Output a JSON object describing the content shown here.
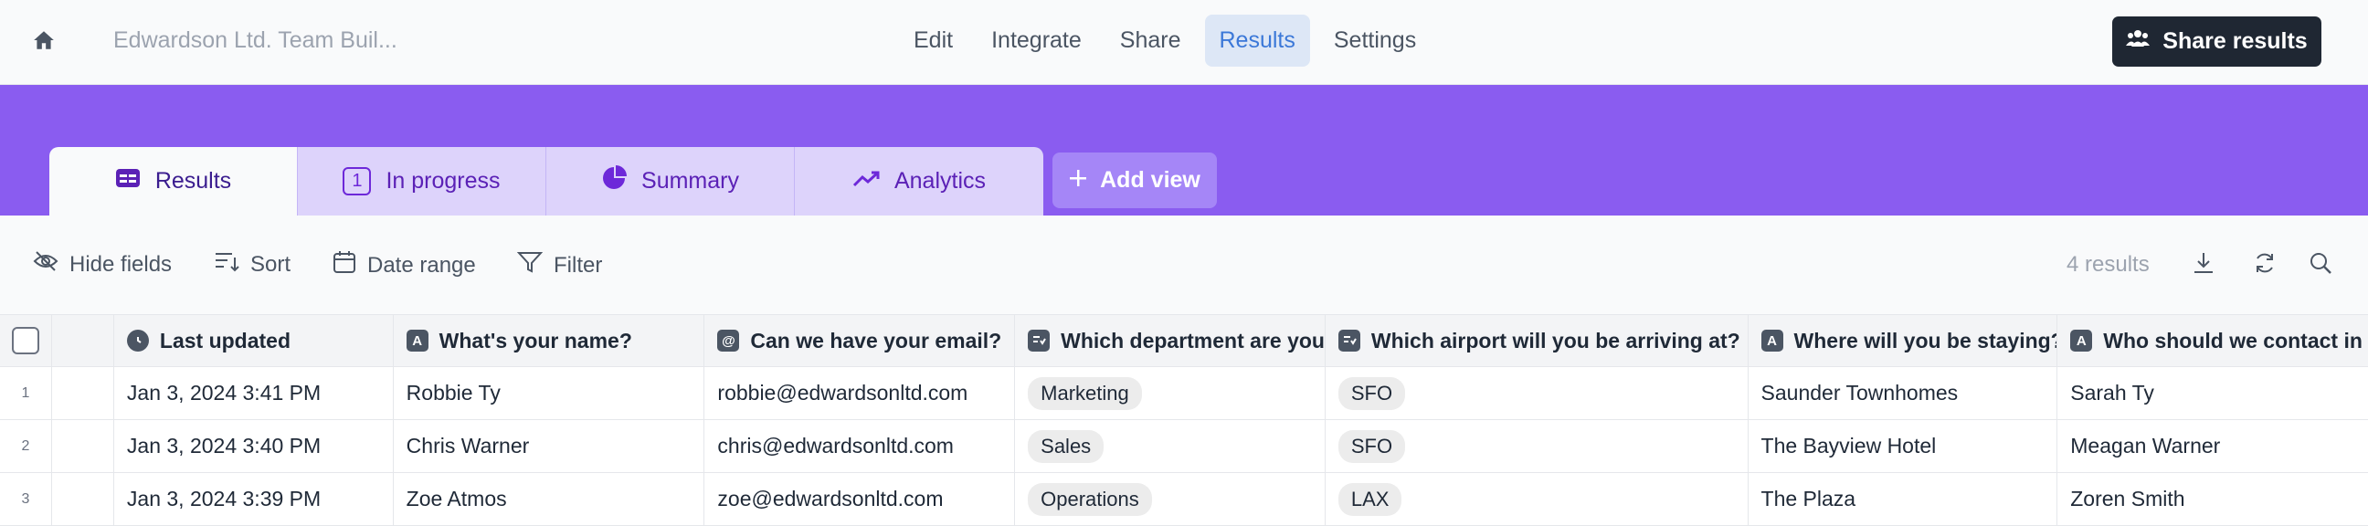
{
  "topbar": {
    "title": "Edwardson Ltd. Team Buil...",
    "nav": [
      "Edit",
      "Integrate",
      "Share",
      "Results",
      "Settings"
    ],
    "share_label": "Share results"
  },
  "tabs": {
    "results": "Results",
    "in_progress": "In progress",
    "in_progress_count": "1",
    "summary": "Summary",
    "analytics": "Analytics",
    "add_view": "Add view"
  },
  "toolbar": {
    "hide_fields": "Hide fields",
    "sort": "Sort",
    "date_range": "Date range",
    "filter": "Filter",
    "results_count": "4 results"
  },
  "table": {
    "headers": [
      "Last updated",
      "What's your name?",
      "Can we have your email?",
      "Which department are you",
      "Which airport will you be arriving at?",
      "Where will you be staying?",
      "Who should we contact in"
    ],
    "rows": [
      {
        "num": "1",
        "updated": "Jan 3, 2024 3:41 PM",
        "name": "Robbie Ty",
        "email": "robbie@edwardsonltd.com",
        "dept": "Marketing",
        "airport": "SFO",
        "stay": "Saunder Townhomes",
        "contact": "Sarah Ty"
      },
      {
        "num": "2",
        "updated": "Jan 3, 2024 3:40 PM",
        "name": "Chris Warner",
        "email": "chris@edwardsonltd.com",
        "dept": "Sales",
        "airport": "SFO",
        "stay": "The Bayview Hotel",
        "contact": "Meagan Warner"
      },
      {
        "num": "3",
        "updated": "Jan 3, 2024 3:39 PM",
        "name": "Zoe Atmos",
        "email": "zoe@edwardsonltd.com",
        "dept": "Operations",
        "airport": "LAX",
        "stay": "The Plaza",
        "contact": "Zoren Smith"
      }
    ]
  },
  "colors": {
    "accent_purple": "#8a5cf0",
    "nav_active": "#3b78d8",
    "share_button": "#1f2733"
  }
}
